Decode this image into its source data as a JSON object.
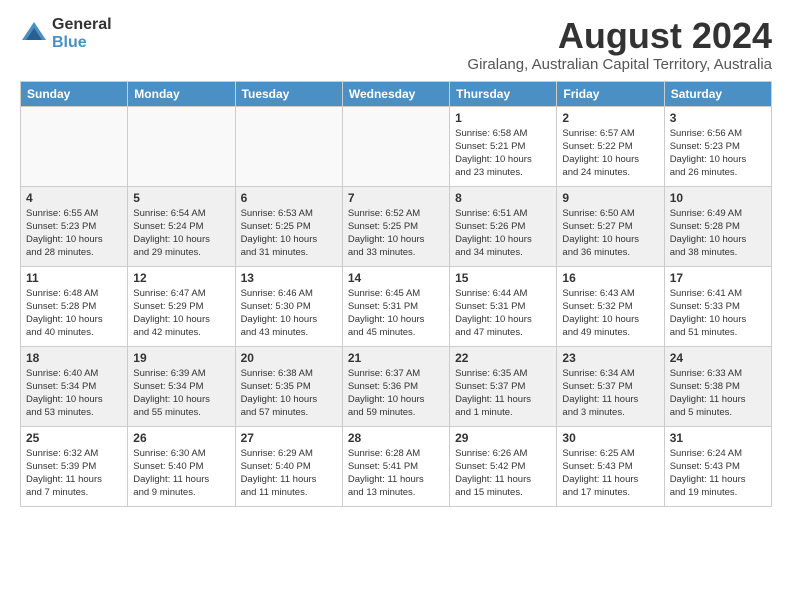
{
  "header": {
    "logo_general": "General",
    "logo_blue": "Blue",
    "title": "August 2024",
    "subtitle": "Giralang, Australian Capital Territory, Australia"
  },
  "days_of_week": [
    "Sunday",
    "Monday",
    "Tuesday",
    "Wednesday",
    "Thursday",
    "Friday",
    "Saturday"
  ],
  "weeks": [
    [
      {
        "day": "",
        "info": ""
      },
      {
        "day": "",
        "info": ""
      },
      {
        "day": "",
        "info": ""
      },
      {
        "day": "",
        "info": ""
      },
      {
        "day": "1",
        "info": "Sunrise: 6:58 AM\nSunset: 5:21 PM\nDaylight: 10 hours\nand 23 minutes."
      },
      {
        "day": "2",
        "info": "Sunrise: 6:57 AM\nSunset: 5:22 PM\nDaylight: 10 hours\nand 24 minutes."
      },
      {
        "day": "3",
        "info": "Sunrise: 6:56 AM\nSunset: 5:23 PM\nDaylight: 10 hours\nand 26 minutes."
      }
    ],
    [
      {
        "day": "4",
        "info": "Sunrise: 6:55 AM\nSunset: 5:23 PM\nDaylight: 10 hours\nand 28 minutes."
      },
      {
        "day": "5",
        "info": "Sunrise: 6:54 AM\nSunset: 5:24 PM\nDaylight: 10 hours\nand 29 minutes."
      },
      {
        "day": "6",
        "info": "Sunrise: 6:53 AM\nSunset: 5:25 PM\nDaylight: 10 hours\nand 31 minutes."
      },
      {
        "day": "7",
        "info": "Sunrise: 6:52 AM\nSunset: 5:25 PM\nDaylight: 10 hours\nand 33 minutes."
      },
      {
        "day": "8",
        "info": "Sunrise: 6:51 AM\nSunset: 5:26 PM\nDaylight: 10 hours\nand 34 minutes."
      },
      {
        "day": "9",
        "info": "Sunrise: 6:50 AM\nSunset: 5:27 PM\nDaylight: 10 hours\nand 36 minutes."
      },
      {
        "day": "10",
        "info": "Sunrise: 6:49 AM\nSunset: 5:28 PM\nDaylight: 10 hours\nand 38 minutes."
      }
    ],
    [
      {
        "day": "11",
        "info": "Sunrise: 6:48 AM\nSunset: 5:28 PM\nDaylight: 10 hours\nand 40 minutes."
      },
      {
        "day": "12",
        "info": "Sunrise: 6:47 AM\nSunset: 5:29 PM\nDaylight: 10 hours\nand 42 minutes."
      },
      {
        "day": "13",
        "info": "Sunrise: 6:46 AM\nSunset: 5:30 PM\nDaylight: 10 hours\nand 43 minutes."
      },
      {
        "day": "14",
        "info": "Sunrise: 6:45 AM\nSunset: 5:31 PM\nDaylight: 10 hours\nand 45 minutes."
      },
      {
        "day": "15",
        "info": "Sunrise: 6:44 AM\nSunset: 5:31 PM\nDaylight: 10 hours\nand 47 minutes."
      },
      {
        "day": "16",
        "info": "Sunrise: 6:43 AM\nSunset: 5:32 PM\nDaylight: 10 hours\nand 49 minutes."
      },
      {
        "day": "17",
        "info": "Sunrise: 6:41 AM\nSunset: 5:33 PM\nDaylight: 10 hours\nand 51 minutes."
      }
    ],
    [
      {
        "day": "18",
        "info": "Sunrise: 6:40 AM\nSunset: 5:34 PM\nDaylight: 10 hours\nand 53 minutes."
      },
      {
        "day": "19",
        "info": "Sunrise: 6:39 AM\nSunset: 5:34 PM\nDaylight: 10 hours\nand 55 minutes."
      },
      {
        "day": "20",
        "info": "Sunrise: 6:38 AM\nSunset: 5:35 PM\nDaylight: 10 hours\nand 57 minutes."
      },
      {
        "day": "21",
        "info": "Sunrise: 6:37 AM\nSunset: 5:36 PM\nDaylight: 10 hours\nand 59 minutes."
      },
      {
        "day": "22",
        "info": "Sunrise: 6:35 AM\nSunset: 5:37 PM\nDaylight: 11 hours\nand 1 minute."
      },
      {
        "day": "23",
        "info": "Sunrise: 6:34 AM\nSunset: 5:37 PM\nDaylight: 11 hours\nand 3 minutes."
      },
      {
        "day": "24",
        "info": "Sunrise: 6:33 AM\nSunset: 5:38 PM\nDaylight: 11 hours\nand 5 minutes."
      }
    ],
    [
      {
        "day": "25",
        "info": "Sunrise: 6:32 AM\nSunset: 5:39 PM\nDaylight: 11 hours\nand 7 minutes."
      },
      {
        "day": "26",
        "info": "Sunrise: 6:30 AM\nSunset: 5:40 PM\nDaylight: 11 hours\nand 9 minutes."
      },
      {
        "day": "27",
        "info": "Sunrise: 6:29 AM\nSunset: 5:40 PM\nDaylight: 11 hours\nand 11 minutes."
      },
      {
        "day": "28",
        "info": "Sunrise: 6:28 AM\nSunset: 5:41 PM\nDaylight: 11 hours\nand 13 minutes."
      },
      {
        "day": "29",
        "info": "Sunrise: 6:26 AM\nSunset: 5:42 PM\nDaylight: 11 hours\nand 15 minutes."
      },
      {
        "day": "30",
        "info": "Sunrise: 6:25 AM\nSunset: 5:43 PM\nDaylight: 11 hours\nand 17 minutes."
      },
      {
        "day": "31",
        "info": "Sunrise: 6:24 AM\nSunset: 5:43 PM\nDaylight: 11 hours\nand 19 minutes."
      }
    ]
  ]
}
